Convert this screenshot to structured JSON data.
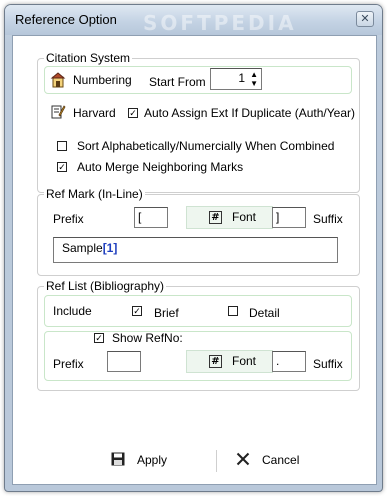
{
  "window": {
    "title": "Reference Option",
    "watermark": "SOFTPEDIA",
    "close_glyph": "✕"
  },
  "citation_system": {
    "group_title": "Citation System",
    "numbering_label": "Numbering",
    "start_from_label": "Start From",
    "start_from_value": "1",
    "harvard_label": "Harvard",
    "auto_assign_label": "Auto Assign Ext If Duplicate (Auth/Year)",
    "auto_assign_checked": true,
    "sort_label": "Sort Alphabetically/Numercially When Combined",
    "sort_checked": false,
    "auto_merge_label": "Auto Merge Neighboring Marks",
    "auto_merge_checked": true
  },
  "ref_mark": {
    "group_title": "Ref Mark (In-Line)",
    "prefix_label": "Prefix",
    "prefix_value": "[",
    "font_label": "Font",
    "suffix_value": "]",
    "suffix_label": "Suffix",
    "sample_text": "Sample",
    "sample_mark": "[1]"
  },
  "ref_list": {
    "group_title": "Ref List (Bibliography)",
    "include_label": "Include",
    "brief_label": "Brief",
    "brief_checked": true,
    "detail_label": "Detail",
    "detail_checked": false,
    "show_refno_label": "Show RefNo:",
    "show_refno_checked": true,
    "prefix_label": "Prefix",
    "prefix_value": "",
    "font_label": "Font",
    "suffix_value": ".",
    "suffix_label": "Suffix"
  },
  "buttons": {
    "apply_label": "Apply",
    "cancel_label": "Cancel"
  },
  "icons": {
    "numbering": "numbering-icon",
    "harvard": "harvard-icon",
    "font": "font-icon",
    "save": "save-icon",
    "close": "close-icon"
  },
  "colors": {
    "sample_mark": "#1f3fbf",
    "green_box_border": "#c9e6c9",
    "font_button_bg": "#eef6ef"
  }
}
